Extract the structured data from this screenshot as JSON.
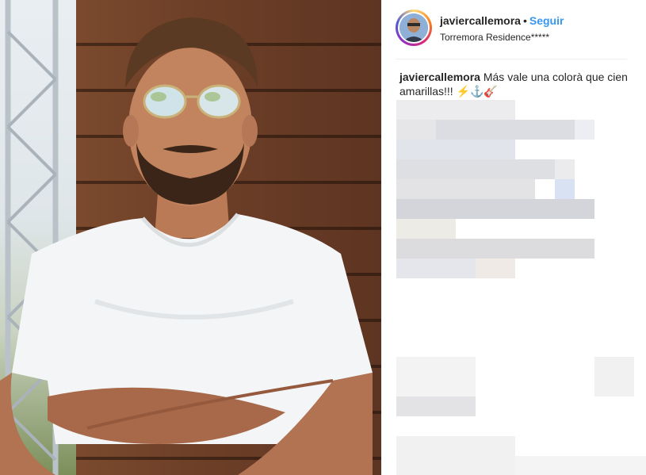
{
  "post": {
    "username": "javiercallemora",
    "separator": "•",
    "follow_label": "Seguir",
    "location": "Torremora Residence*****"
  },
  "caption": {
    "username": "javiercallemora",
    "text": "Más vale una colorà que cien amarillas!!! ⚡⚓🎸"
  },
  "icons": {
    "avatar": "profile-avatar",
    "emoji": [
      "lightning-emoji",
      "anchor-emoji",
      "guitar-emoji"
    ]
  },
  "colors": {
    "follow": "#3897f0",
    "text": "#262626",
    "divider": "#efefef",
    "story_ring": [
      "#feda75",
      "#fa7e1e",
      "#d62976",
      "#962fbf",
      "#4f5bd5"
    ]
  }
}
